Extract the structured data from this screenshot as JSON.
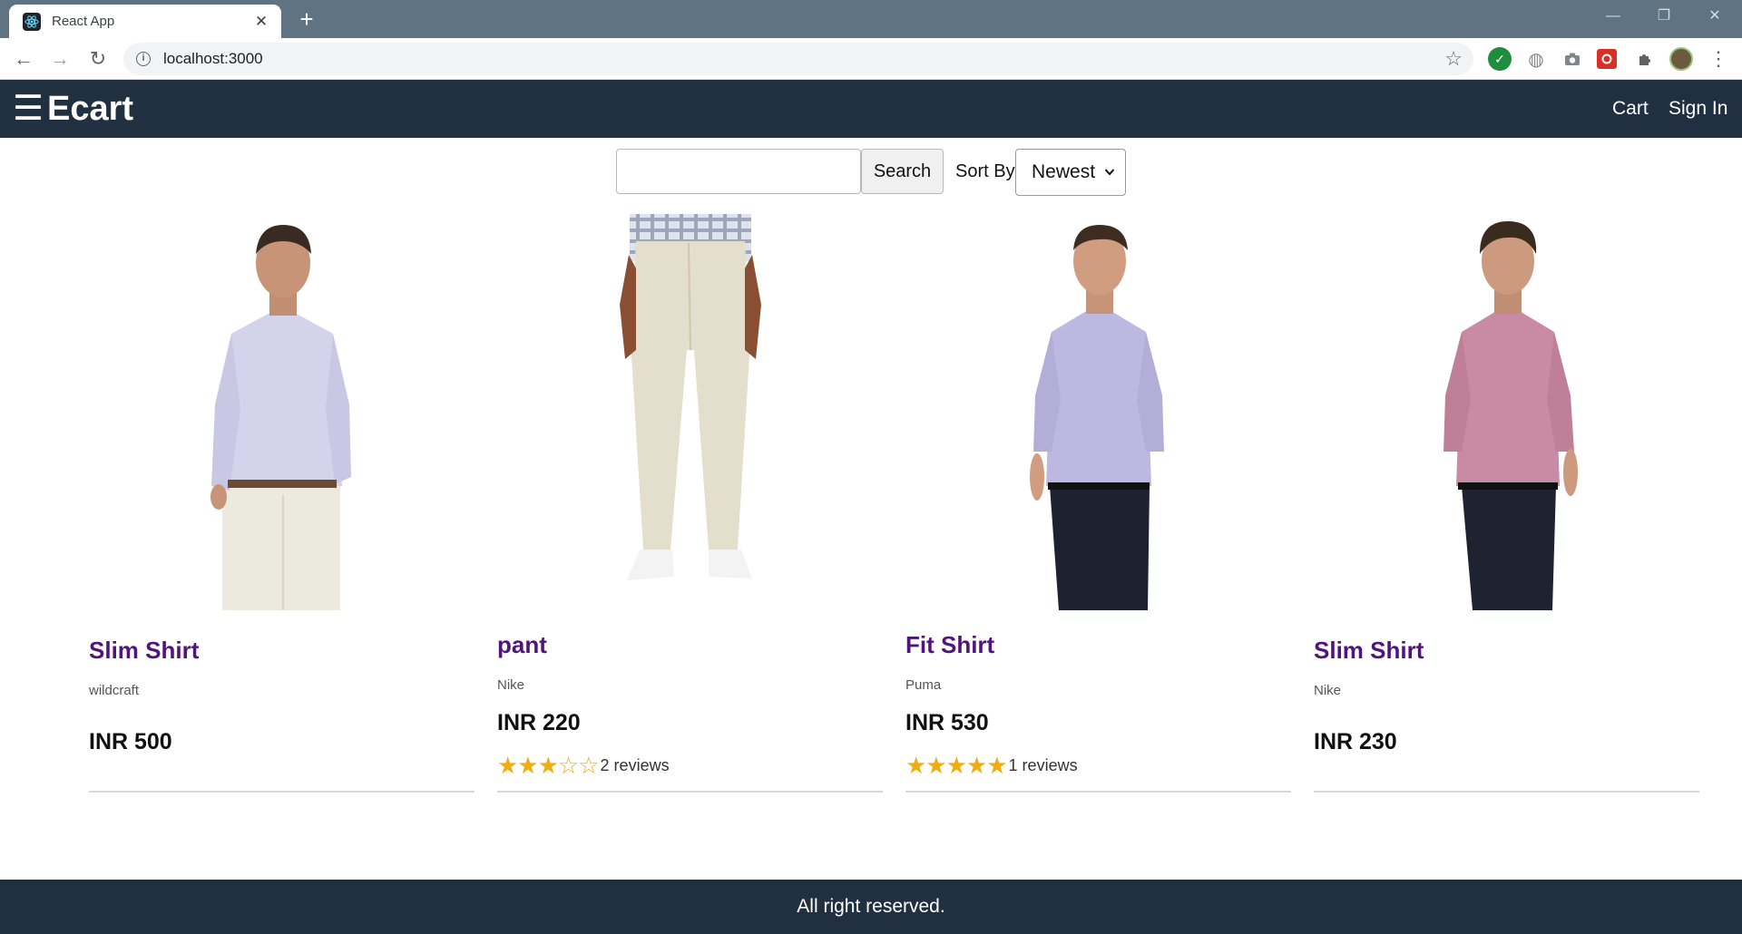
{
  "browser": {
    "tab_title": "React App",
    "tab_close": "✕",
    "new_tab": "+",
    "url": "localhost:3000",
    "back": "←",
    "forward": "→",
    "reload": "↻",
    "bookmark": "☆",
    "menu": "⋮",
    "minimize": "—",
    "restore": "❐",
    "close": "✕"
  },
  "header": {
    "menu_icon": "☰",
    "brand": "Ecart",
    "cart_link": "Cart",
    "signin_link": "Sign In",
    "background_color": "#203040"
  },
  "filters": {
    "search_value": "",
    "search_button": "Search",
    "sort_label": "Sort By",
    "sort_selected": "Newest",
    "sort_chevron": "⌄"
  },
  "products": [
    {
      "name": "Slim Shirt",
      "brand": "wildcraft",
      "price": "INR 500",
      "rating": null,
      "reviews": null,
      "image": "man-shirt-lavender-white-pants"
    },
    {
      "name": "pant",
      "brand": "Nike",
      "price": "INR 220",
      "rating": 3,
      "reviews": "2 reviews",
      "image": "beige-pants"
    },
    {
      "name": "Fit Shirt",
      "brand": "Puma",
      "price": "INR 530",
      "rating": 5,
      "reviews": "1 reviews",
      "image": "man-shirt-purple-dark-pants"
    },
    {
      "name": "Slim Shirt",
      "brand": "Nike",
      "price": "INR 230",
      "rating": null,
      "reviews": null,
      "image": "man-shirt-pink-dark-pants"
    }
  ],
  "ratings": {
    "pant": "★★★☆☆",
    "fit_shirt": "★★★★★"
  },
  "colors": {
    "product_name": "#51137c",
    "star": "#f0ad12"
  },
  "footer": {
    "text": "All right reserved."
  }
}
